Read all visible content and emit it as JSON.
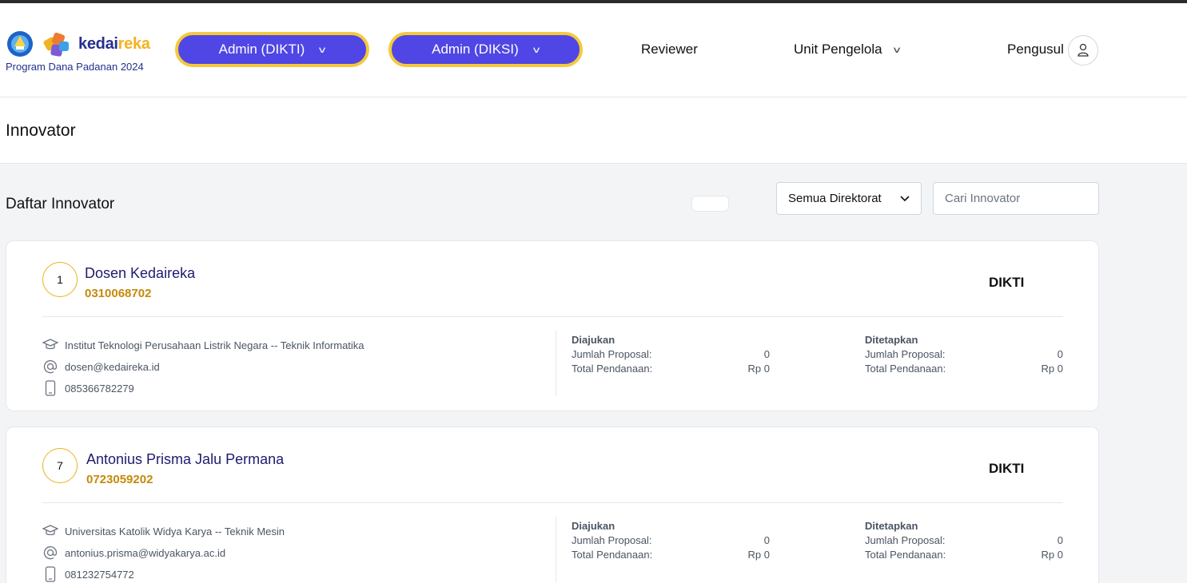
{
  "header": {
    "brand_a": "kedai",
    "brand_b": "reka",
    "program": "Program Dana Padanan 2024",
    "admin_dikti": "Admin (DIKTI)",
    "admin_diksi": "Admin (DIKSI)",
    "reviewer": "Reviewer",
    "unit_pengelola": "Unit Pengelola",
    "pengusul": "Pengusul"
  },
  "page": {
    "title": "Innovator",
    "list_title": "Daftar Innovator"
  },
  "filters": {
    "directorate_selected": "Semua Direktorat",
    "search_placeholder": "Cari Innovator"
  },
  "labels": {
    "diajukan": "Diajukan",
    "ditetapkan": "Ditetapkan",
    "jumlah_proposal": "Jumlah Proposal:",
    "total_pendanaan": "Total Pendanaan:"
  },
  "innovators": [
    {
      "number": "1",
      "name": "Dosen Kedaireka",
      "id": "0310068702",
      "directorate": "DIKTI",
      "institution": "Institut Teknologi Perusahaan Listrik Negara -- Teknik Informatika",
      "email": "dosen@kedaireka.id",
      "phone": "085366782279",
      "diajukan_jumlah": "0",
      "diajukan_total": "Rp 0",
      "ditetapkan_jumlah": "0",
      "ditetapkan_total": "Rp 0"
    },
    {
      "number": "7",
      "name": "Antonius Prisma Jalu Permana",
      "id": "0723059202",
      "directorate": "DIKTI",
      "institution": "Universitas Katolik Widya Karya -- Teknik Mesin",
      "email": "antonius.prisma@widyakarya.ac.id",
      "phone": "081232754772",
      "diajukan_jumlah": "0",
      "diajukan_total": "Rp 0",
      "ditetapkan_jumlah": "0",
      "ditetapkan_total": "Rp 0"
    }
  ],
  "colors": {
    "primary_button": "#4f46e5",
    "button_border": "#f5c93b",
    "name_text": "#1e1b6e",
    "id_text": "#c48a0a"
  }
}
